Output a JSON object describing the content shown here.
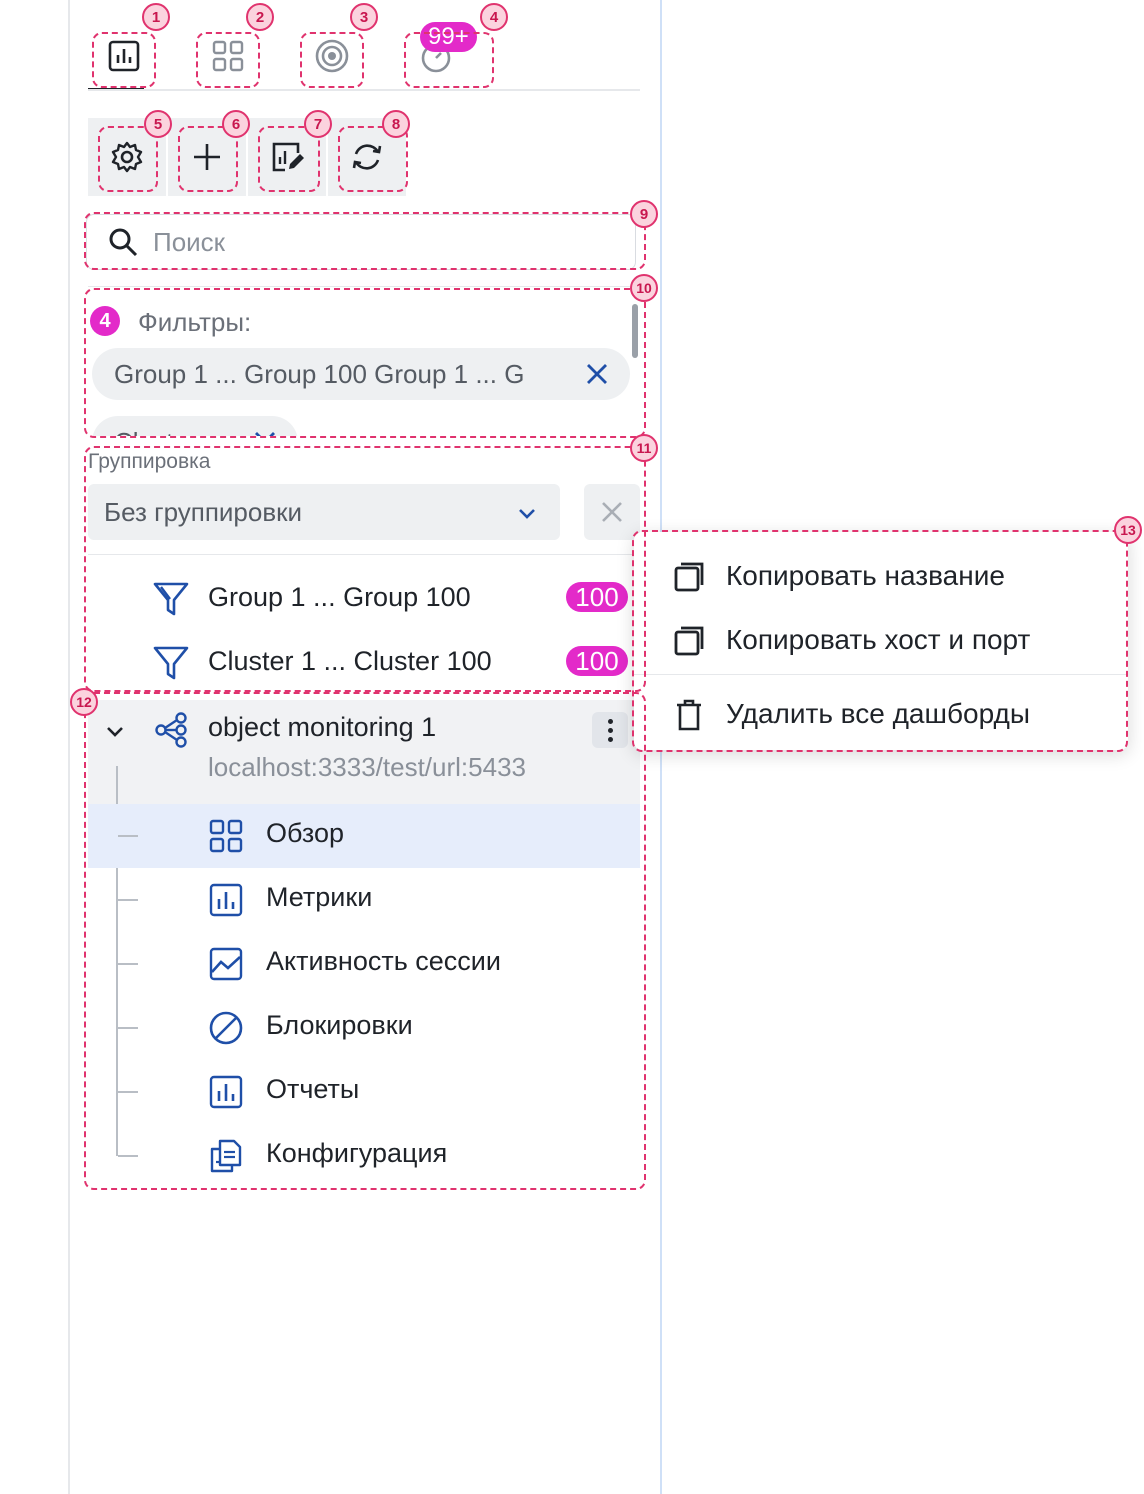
{
  "tabs": [
    {
      "name": "metrics",
      "icon": "bar-chart-icon",
      "active": true
    },
    {
      "name": "overview",
      "icon": "grid-icon",
      "active": false
    },
    {
      "name": "target",
      "icon": "target-icon",
      "active": false
    },
    {
      "name": "history",
      "icon": "clock-icon",
      "active": false,
      "badge": "99+"
    }
  ],
  "toolbar": [
    {
      "name": "settings",
      "icon": "gear-icon"
    },
    {
      "name": "add",
      "icon": "plus-icon"
    },
    {
      "name": "edit-dashboard",
      "icon": "edit-chart-icon"
    },
    {
      "name": "refresh",
      "icon": "refresh-icon"
    }
  ],
  "search": {
    "placeholder": "Поиск",
    "value": ""
  },
  "filters": {
    "count": "4",
    "label": "Фильтры:",
    "chips": [
      "Group 1 ... Group 100 Group 1 ... G",
      "Clusters"
    ]
  },
  "grouping": {
    "label": "Группировка",
    "selected": "Без группировки"
  },
  "group_list": [
    {
      "label": "Group 1 ... Group 100",
      "count": "100",
      "icon": "funnel-icon"
    },
    {
      "label": "Cluster 1 ... Cluster 100",
      "count": "100",
      "icon": "funnel-icon"
    }
  ],
  "object": {
    "title": "object monitoring 1",
    "subtitle": "localhost:3333/test/url:5433",
    "icon": "topology-icon",
    "children": [
      {
        "label": "Обзор",
        "icon": "grid-icon",
        "selected": true
      },
      {
        "label": "Метрики",
        "icon": "bar-chart-icon",
        "selected": false
      },
      {
        "label": "Активность сессии",
        "icon": "line-chart-icon",
        "selected": false
      },
      {
        "label": "Блокировки",
        "icon": "blocked-icon",
        "selected": false
      },
      {
        "label": "Отчеты",
        "icon": "bar-chart-icon",
        "selected": false
      },
      {
        "label": "Конфигурация",
        "icon": "documents-icon",
        "selected": false
      }
    ]
  },
  "context_menu": [
    {
      "label": "Копировать название",
      "icon": "copy-icon"
    },
    {
      "label": "Копировать хост и порт",
      "icon": "copy-icon"
    },
    {
      "label": "Удалить все дашборды",
      "icon": "trash-icon"
    }
  ],
  "annotations": [
    "1",
    "2",
    "3",
    "4",
    "5",
    "6",
    "7",
    "8",
    "9",
    "10",
    "11",
    "12",
    "13"
  ],
  "colors": {
    "accent": "#1f4fa8",
    "badge": "#e32ac9",
    "annotation": "#e0336e",
    "selected_row": "#e6edfb"
  }
}
